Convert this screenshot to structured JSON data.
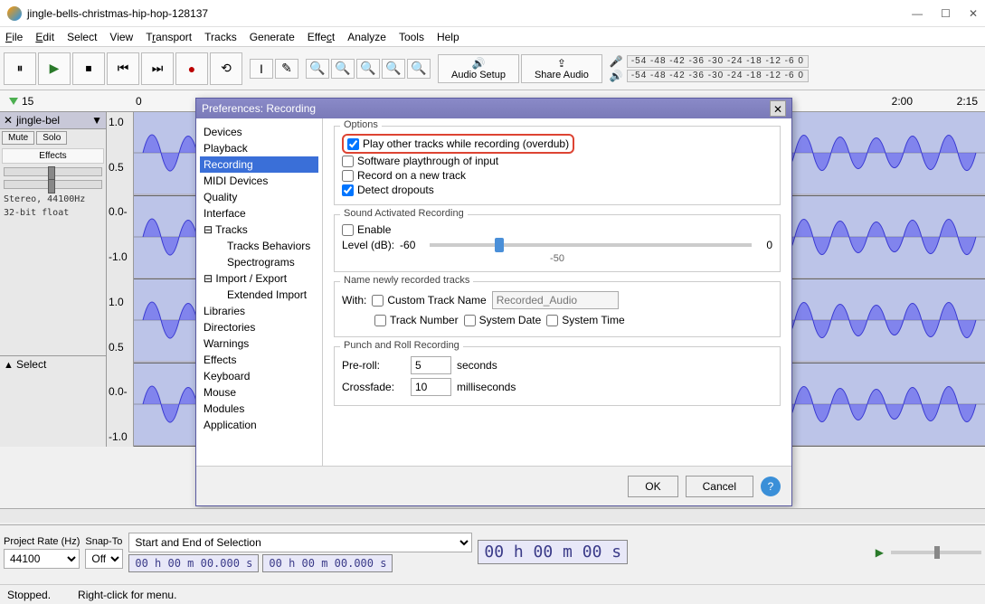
{
  "window": {
    "title": "jingle-bells-christmas-hip-hop-128137"
  },
  "menu": {
    "file": "File",
    "edit": "Edit",
    "select": "Select",
    "view": "View",
    "transport": "Transport",
    "tracks": "Tracks",
    "generate": "Generate",
    "effect": "Effect",
    "analyze": "Analyze",
    "tools": "Tools",
    "help": "Help"
  },
  "toolbar": {
    "audio_setup": "Audio Setup",
    "share_audio": "Share Audio"
  },
  "meters": {
    "rec": "-54 -48 -42 -36 -30 -24 -18 -12 -6  0",
    "play": "-54 -48 -42 -36 -30 -24 -18 -12 -6  0"
  },
  "ruler": {
    "t0": "15",
    "t1": "0",
    "t2": "2:00",
    "t3": "2:15"
  },
  "track": {
    "name": "jingle-bel",
    "mute": "Mute",
    "solo": "Solo",
    "effects": "Effects",
    "info1": "Stereo, 44100Hz",
    "info2": "32-bit float",
    "select": "Select",
    "amp_top": "1.0",
    "amp_mid": "0.5",
    "amp_zero": "0.0-",
    "amp_neg": "-1.0"
  },
  "prefs": {
    "title": "Preferences: Recording",
    "tree": {
      "devices": "Devices",
      "playback": "Playback",
      "recording": "Recording",
      "midi": "MIDI Devices",
      "quality": "Quality",
      "interface": "Interface",
      "tracks": "Tracks",
      "tracks_beh": "Tracks Behaviors",
      "spectro": "Spectrograms",
      "impexp": "Import / Export",
      "extimp": "Extended Import",
      "libraries": "Libraries",
      "directories": "Directories",
      "warnings": "Warnings",
      "effects": "Effects",
      "keyboard": "Keyboard",
      "mouse": "Mouse",
      "modules": "Modules",
      "application": "Application"
    },
    "sections": {
      "options": "Options",
      "overdub": "Play other tracks while recording (overdub)",
      "playthrough": "Software playthrough of input",
      "newtrack": "Record on a new track",
      "dropouts": "Detect dropouts",
      "sar": "Sound Activated Recording",
      "enable": "Enable",
      "level": "Level (dB):",
      "level_min": "-60",
      "level_tick": "-50",
      "level_max": "0",
      "naming": "Name newly recorded tracks",
      "with": "With:",
      "custom_name": "Custom Track Name",
      "name_placeholder": "Recorded_Audio",
      "track_number": "Track Number",
      "sys_date": "System Date",
      "sys_time": "System Time",
      "punch": "Punch and Roll Recording",
      "preroll": "Pre-roll:",
      "preroll_val": "5",
      "seconds": "seconds",
      "crossfade": "Crossfade:",
      "crossfade_val": "10",
      "ms": "milliseconds"
    },
    "ok": "OK",
    "cancel": "Cancel"
  },
  "bottom": {
    "proj_rate": "Project Rate (Hz)",
    "snap": "Snap-To",
    "rate_val": "44100",
    "snap_val": "Off",
    "sel_label": "Start and End of Selection",
    "tc1": "00 h 00 m 00.000 s",
    "tc2": "00 h 00 m 00.000 s",
    "bigtc": "00 h 00 m 00 s"
  },
  "status": {
    "left": "Stopped.",
    "right": "Right-click for menu."
  }
}
